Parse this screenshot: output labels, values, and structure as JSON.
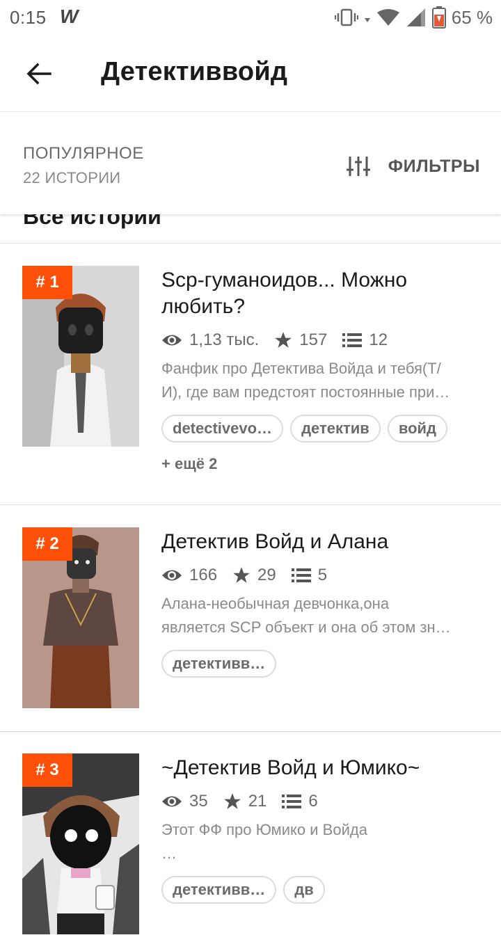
{
  "status_bar": {
    "time": "0:15",
    "app_icon": "W",
    "battery_percent": "65 %"
  },
  "header": {
    "title": "Детективвойд"
  },
  "sort_bar": {
    "sort_label": "ПОПУЛЯРНОЕ",
    "count_label": "22 ИСТОРИИ",
    "filter_label": "ФИЛЬТРЫ"
  },
  "section": {
    "title": "Все истории"
  },
  "stories": [
    {
      "rank": "# 1",
      "title": "Scp-гуманоидов... Можно любить?",
      "reads": "1,13 тыс.",
      "votes": "157",
      "parts": "12",
      "description_lines": [
        "Фанфик про Детектива Войда и тебя(Т/",
        "И), где вам предстоят постоянные при…"
      ],
      "tags": [
        "detectivevo…",
        "детектив",
        "войд"
      ],
      "more_tags": "+ ещё 2"
    },
    {
      "rank": "# 2",
      "title": "Детектив Войд и Алана",
      "reads": "166",
      "votes": "29",
      "parts": "5",
      "description_lines": [
        "Алана-необычная девчонка,она",
        "является SCP объект и она об этом зн…"
      ],
      "tags": [
        "детективв…"
      ],
      "more_tags": ""
    },
    {
      "rank": "# 3",
      "title": "~Детектив Войд и Юмико~",
      "reads": "35",
      "votes": "21",
      "parts": "6",
      "description_lines": [
        "Этот ФФ про Юмико и Войда",
        "…"
      ],
      "tags": [
        "детективв…",
        "дв"
      ],
      "more_tags": ""
    }
  ],
  "icons": {
    "back": "arrow-left-icon",
    "filter": "sliders-icon",
    "reads": "eye-icon",
    "votes": "star-icon",
    "parts": "list-icon"
  },
  "colors": {
    "accent": "#ff500a",
    "text_primary": "#1a1a1a",
    "text_secondary": "#6b6b6b",
    "text_muted": "#8a8a8a",
    "divider": "#dcdcdc"
  }
}
